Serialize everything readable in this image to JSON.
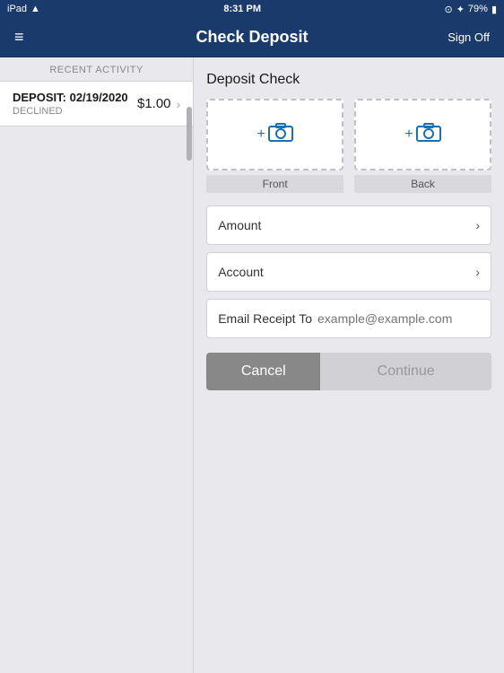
{
  "statusBar": {
    "carrier": "iPad",
    "wifi": "wifi",
    "time": "8:31 PM",
    "airplay": "airplay",
    "bluetooth": "bluetooth",
    "battery": "79%"
  },
  "navBar": {
    "menuLabel": "≡",
    "title": "Check Deposit",
    "signOffLabel": "Sign Off"
  },
  "leftPanel": {
    "recentActivityLabel": "RECENT ACTIVITY",
    "depositItem": {
      "prefix": "DEPOSIT:",
      "date": "02/19/2020",
      "status": "DECLINED",
      "amount": "$1.00"
    }
  },
  "rightPanel": {
    "title": "Deposit Check",
    "front": {
      "cameraLabel": "Front",
      "plusSign": "+",
      "iconSymbol": "📷"
    },
    "back": {
      "cameraLabel": "Back",
      "plusSign": "+",
      "iconSymbol": "📷"
    },
    "amountLabel": "Amount",
    "accountLabel": "Account",
    "emailSection": {
      "label": "Email Receipt To",
      "placeholder": "example@example.com"
    },
    "cancelButton": "Cancel",
    "continueButton": "Continue"
  }
}
